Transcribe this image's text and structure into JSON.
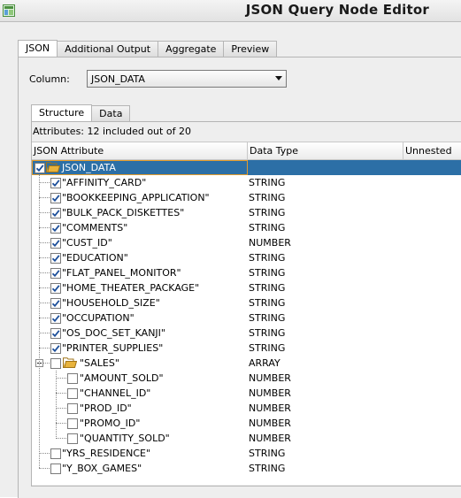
{
  "window": {
    "title": "JSON Query Node Editor"
  },
  "main_tabs": [
    "JSON",
    "Additional Output",
    "Aggregate",
    "Preview"
  ],
  "column": {
    "label": "Column:",
    "value": "JSON_DATA"
  },
  "sub_tabs": [
    "Structure",
    "Data"
  ],
  "attributes_summary": "Attributes: 12 included out of 20",
  "table": {
    "headers": {
      "attribute": "JSON Attribute",
      "type": "Data Type",
      "unnested": "Unnested"
    },
    "rows": [
      {
        "name": "JSON_DATA",
        "type": "",
        "checked": true,
        "folder": true,
        "selected": true
      },
      {
        "name": "\"AFFINITY_CARD\"",
        "type": "STRING",
        "checked": true
      },
      {
        "name": "\"BOOKKEEPING_APPLICATION\"",
        "type": "STRING",
        "checked": true
      },
      {
        "name": "\"BULK_PACK_DISKETTES\"",
        "type": "STRING",
        "checked": true
      },
      {
        "name": "\"COMMENTS\"",
        "type": "STRING",
        "checked": true
      },
      {
        "name": "\"CUST_ID\"",
        "type": "NUMBER",
        "checked": true
      },
      {
        "name": "\"EDUCATION\"",
        "type": "STRING",
        "checked": true
      },
      {
        "name": "\"FLAT_PANEL_MONITOR\"",
        "type": "STRING",
        "checked": true
      },
      {
        "name": "\"HOME_THEATER_PACKAGE\"",
        "type": "STRING",
        "checked": true
      },
      {
        "name": "\"HOUSEHOLD_SIZE\"",
        "type": "STRING",
        "checked": true
      },
      {
        "name": "\"OCCUPATION\"",
        "type": "STRING",
        "checked": true
      },
      {
        "name": "\"OS_DOC_SET_KANJI\"",
        "type": "STRING",
        "checked": true
      },
      {
        "name": "\"PRINTER_SUPPLIES\"",
        "type": "STRING",
        "checked": true
      },
      {
        "name": "\"SALES\"",
        "type": "ARRAY",
        "checked": false,
        "folder": true
      },
      {
        "name": "\"AMOUNT_SOLD\"",
        "type": "NUMBER",
        "checked": false,
        "child": true
      },
      {
        "name": "\"CHANNEL_ID\"",
        "type": "NUMBER",
        "checked": false,
        "child": true
      },
      {
        "name": "\"PROD_ID\"",
        "type": "NUMBER",
        "checked": false,
        "child": true
      },
      {
        "name": "\"PROMO_ID\"",
        "type": "NUMBER",
        "checked": false,
        "child": true
      },
      {
        "name": "\"QUANTITY_SOLD\"",
        "type": "NUMBER",
        "checked": false,
        "child": true
      },
      {
        "name": "\"YRS_RESIDENCE\"",
        "type": "STRING",
        "checked": false
      },
      {
        "name": "\"Y_BOX_GAMES\"",
        "type": "STRING",
        "checked": false
      }
    ]
  },
  "colors": {
    "selection": "#2c6fa6",
    "folder": "#e8b33c",
    "panel": "#eeeeee"
  }
}
